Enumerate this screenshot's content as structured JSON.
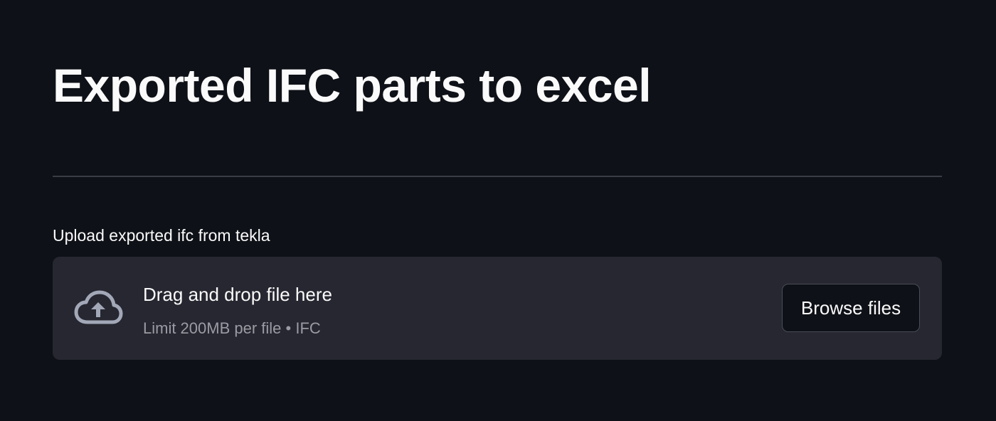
{
  "page": {
    "title": "Exported IFC parts to excel"
  },
  "uploader": {
    "label": "Upload exported ifc from tekla",
    "dropzone": {
      "icon": "cloud-upload-icon",
      "instruction": "Drag and drop file here",
      "limit_text": "Limit 200MB per file • IFC"
    },
    "browse_button_label": "Browse files"
  },
  "colors": {
    "background": "#0e1117",
    "dropzone_background": "#262730",
    "text_primary": "#fafafa",
    "text_secondary": "#9a9ba3",
    "divider": "#3a3d45",
    "icon": "#a3a8b8"
  }
}
